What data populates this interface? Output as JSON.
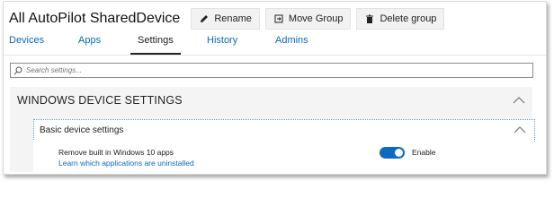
{
  "header": {
    "title": "All AutoPilot SharedDevice",
    "buttons": {
      "rename": "Rename",
      "move_group": "Move Group",
      "delete_group": "Delete group"
    }
  },
  "tabs": [
    {
      "label": "Devices",
      "active": false
    },
    {
      "label": "Apps",
      "active": false
    },
    {
      "label": "Settings",
      "active": true
    },
    {
      "label": "History",
      "active": false
    },
    {
      "label": "Admins",
      "active": false
    }
  ],
  "search": {
    "placeholder": "Search settings..."
  },
  "section": {
    "title": "WINDOWS DEVICE SETTINGS",
    "expanded": true,
    "subsection": {
      "title": "Basic device settings",
      "expanded": true,
      "setting": {
        "label": "Remove built in Windows 10 apps",
        "link": "Learn which applications are uninstalled",
        "toggle_on": true,
        "toggle_label": "Enable"
      }
    }
  },
  "colors": {
    "accent": "#0a6abf",
    "section_bg": "#f4f4f4",
    "button_bg": "#f2f2f2"
  },
  "icons": [
    "pencil-icon",
    "move-icon",
    "trash-icon",
    "search-icon",
    "chevron-up-icon"
  ]
}
